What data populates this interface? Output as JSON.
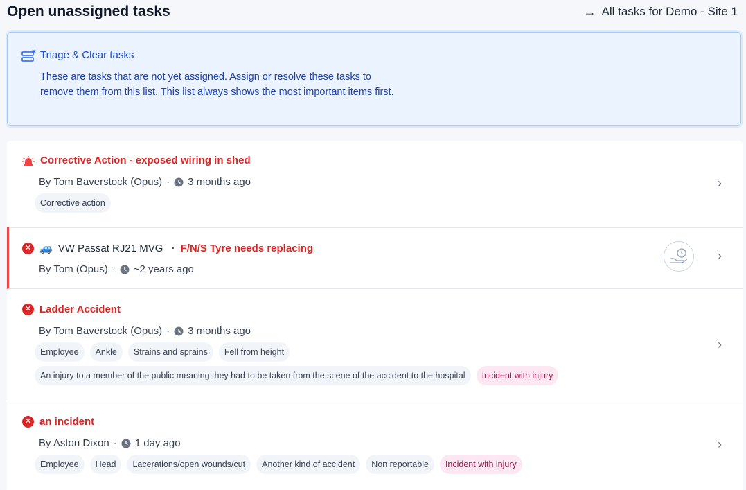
{
  "header": {
    "title": "Open unassigned tasks",
    "all_tasks_link": "All tasks for Demo - Site 1"
  },
  "callout": {
    "title": "Triage & Clear tasks",
    "text": "These are tasks that are not yet assigned. Assign or resolve these tasks to remove them from this list. This list always shows the most important items first."
  },
  "tasks": [
    {
      "icon": "siren-icon",
      "title": "Corrective Action - exposed wiring in shed",
      "author": "By Tom Baverstock (Opus)",
      "time": "3 months ago",
      "chips": [
        "Corrective action"
      ]
    },
    {
      "icon": "x-circle-icon",
      "vehicle": "VW Passat RJ21 MVG",
      "title": "F/N/S Tyre needs replacing",
      "author": "By Tom (Opus)",
      "time": "~2 years ago",
      "chips": [],
      "flagged": true
    },
    {
      "icon": "x-circle-icon",
      "title": "Ladder Accident",
      "author": "By Tom Baverstock (Opus)",
      "time": "3 months ago",
      "chips": [
        "Employee",
        "Ankle",
        "Strains and sprains",
        "Fell from height"
      ],
      "chips2": [
        "An injury to a member of the public meaning they had to be taken from the scene of the accident to the hospital",
        "Incident with injury"
      ]
    },
    {
      "icon": "x-circle-icon",
      "title": "an incident",
      "author": "By Aston Dixon",
      "time": "1 day ago",
      "chips": [
        "Employee",
        "Head",
        "Lacerations/open wounds/cut",
        "Another kind of accident",
        "Non reportable",
        "Incident with injury"
      ]
    }
  ],
  "colors": {
    "accent": "#dc2626",
    "callout_bg": "#eaf3ff",
    "callout_text": "#1e40af"
  }
}
